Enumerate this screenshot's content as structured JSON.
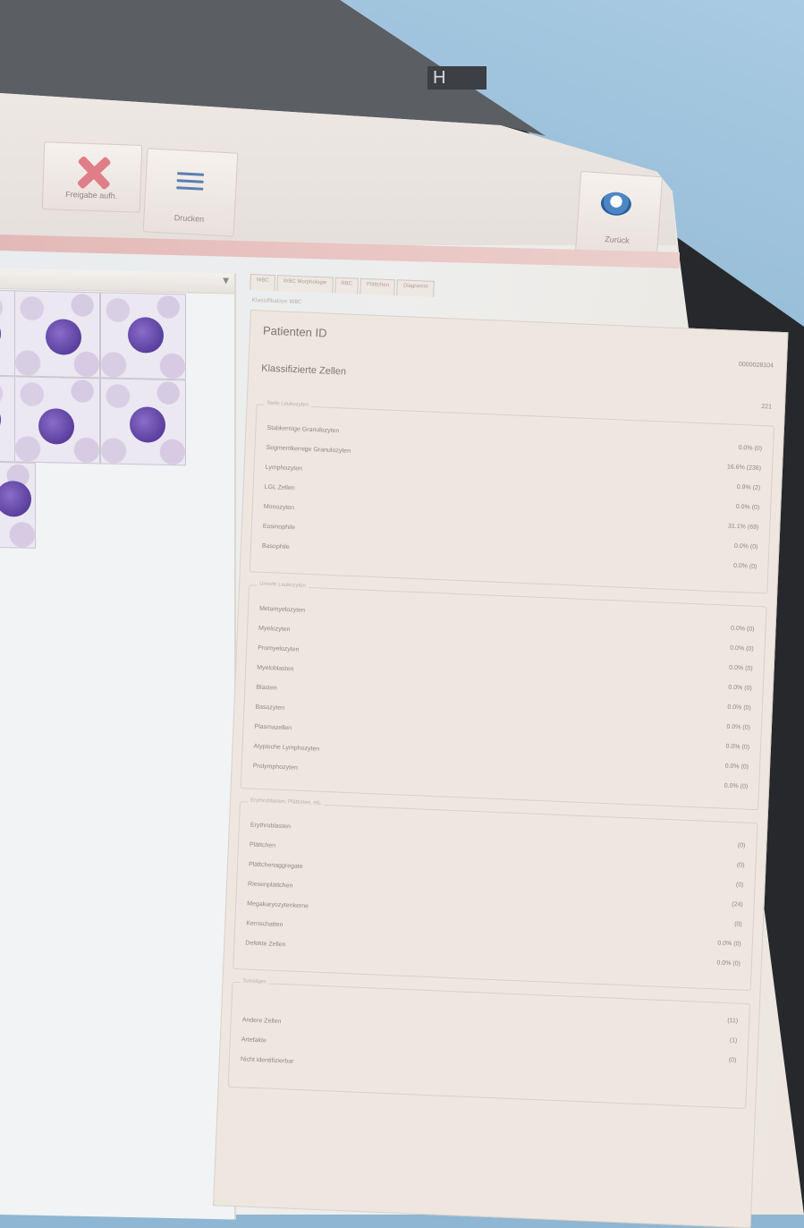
{
  "brand": "H",
  "toolbar": {
    "release_label": "Freigabe aufh.",
    "print_label": "Drucken",
    "back_label": "Zurück"
  },
  "tabs": [
    "WBC",
    "WBC Morphologie",
    "RBC",
    "Plättchen",
    "Diagramm"
  ],
  "subtitle": "Klassifikation WBC",
  "summary": {
    "patient_id_label": "Patienten ID",
    "patient_id_value": "0000028104",
    "classified_label": "Klassifizierte Zellen",
    "classified_value": "221"
  },
  "groups": [
    {
      "title": "Reife Leukozyten",
      "rows": [
        {
          "label": "Stabkernige Granulozyten",
          "value": "0.0% (0)"
        },
        {
          "label": "Segmentkernige Granulozyten",
          "value": "16.6% (236)"
        },
        {
          "label": "Lymphozyten",
          "value": "0.9% (2)"
        },
        {
          "label": "LGL Zellen",
          "value": "0.0% (0)"
        },
        {
          "label": "Monozyten",
          "value": "31.1% (69)"
        },
        {
          "label": "Eosinophile",
          "value": "0.0% (0)"
        },
        {
          "label": "Basophile",
          "value": "0.0% (0)"
        }
      ]
    },
    {
      "title": "Unreife Leukozyten",
      "rows": [
        {
          "label": "Metamyelozyten",
          "value": "0.0% (0)"
        },
        {
          "label": "Myelozyten",
          "value": "0.0% (0)"
        },
        {
          "label": "Promyelozyten",
          "value": "0.0% (0)"
        },
        {
          "label": "Myeloblasten",
          "value": "0.0% (0)"
        },
        {
          "label": "Blasten",
          "value": "0.0% (0)"
        },
        {
          "label": "Basozyten",
          "value": "0.0% (0)"
        },
        {
          "label": "Plasmazellen",
          "value": "0.0% (0)"
        },
        {
          "label": "Atypische Lymphozyten",
          "value": "0.0% (0)"
        },
        {
          "label": "Prolymphozyten",
          "value": "0.0% (0)"
        }
      ]
    },
    {
      "title": "Erythroblasten, Plättchen, etc.",
      "rows": [
        {
          "label": "Erythroblasten",
          "value": "(0)"
        },
        {
          "label": "Plättchen",
          "value": "(0)"
        },
        {
          "label": "Plättchenaggregate",
          "value": "(0)"
        },
        {
          "label": "Riesenplättchen",
          "value": "(24)"
        },
        {
          "label": "Megakaryozytenkerne",
          "value": "(0)"
        },
        {
          "label": "Kernschatten",
          "value": "0.0% (0)"
        },
        {
          "label": "Defekte Zellen",
          "value": "0.0% (0)"
        }
      ]
    },
    {
      "title": "Sonstiges",
      "rows": [
        {
          "label": "",
          "value": "(11)"
        },
        {
          "label": "Andere Zellen",
          "value": "(1)"
        },
        {
          "label": "Artefakte",
          "value": "(0)"
        },
        {
          "label": "Nicht identifizierbar",
          "value": ""
        }
      ]
    }
  ],
  "colors": {
    "accent_pink": "#e2b9b7",
    "release_icon": "#e07e87",
    "print_icon": "#5b7fb0",
    "nucleus": "#5a3f9e"
  }
}
